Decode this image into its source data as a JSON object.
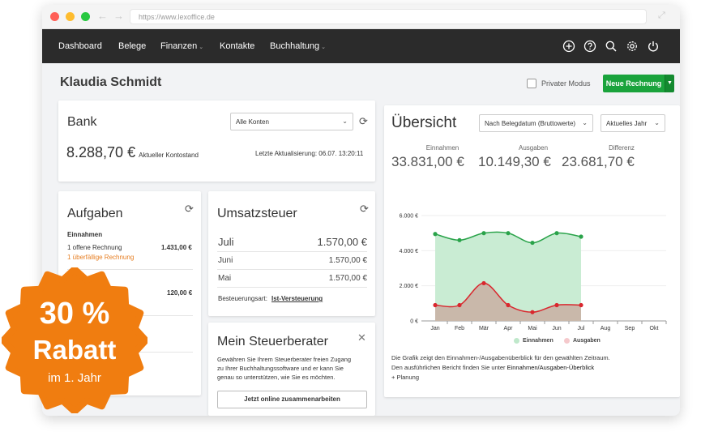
{
  "browser": {
    "url": "https://www.lexoffice.de"
  },
  "navbar": {
    "items": [
      {
        "label": "Dashboard"
      },
      {
        "label": "Belege"
      },
      {
        "label": "Finanzen"
      },
      {
        "label": "Kontakte"
      },
      {
        "label": "Buchhaltung"
      }
    ],
    "icons": [
      "plus-circle-icon",
      "help-icon",
      "search-icon",
      "gear-icon",
      "power-icon"
    ]
  },
  "header": {
    "user_name": "Klaudia Schmidt",
    "private_mode_label": "Privater Modus",
    "private_mode_checked": false,
    "new_invoice_label": "Neue Rechnung"
  },
  "bank": {
    "title": "Bank",
    "account_select": "Alle Konten",
    "balance": "8.288,70 €",
    "balance_label": "Aktueller Kontostand",
    "last_update": "Letzte Aktualisierung: 06.07.  13:20:11"
  },
  "tasks": {
    "title": "Aufgaben",
    "section_income": "Einnahmen",
    "open_invoices_label": "1  offene Rechnung",
    "open_invoices_amount": "1.431,00 €",
    "overdue_label": "1  überfällige Rechnung",
    "second_amount": "120,00 €"
  },
  "vat": {
    "title": "Umsatzsteuer",
    "rows": [
      {
        "month": "Juli",
        "amount": "1.570,00 €"
      },
      {
        "month": "Juni",
        "amount": "1.570,00 €"
      },
      {
        "month": "Mai",
        "amount": "1.570,00 €"
      }
    ],
    "taxation_label": "Besteuerungsart:",
    "taxation_value": "Ist-Versteuerung"
  },
  "advisor": {
    "title": "Mein Steuerberater",
    "text_line1": "Gewähren Sie Ihrem Steuerberater freien Zugang",
    "text_line2": "zu Ihrer Buchhaltungssoftware und er kann Sie",
    "text_line3": "genau so unterstützen, wie Sie es möchten.",
    "button_label": "Jetzt online zusammenarbeiten"
  },
  "overview": {
    "title": "Übersicht",
    "filter_select": "Nach Belegdatum (Bruttowerte)",
    "period_select": "Aktuelles Jahr",
    "kpis": [
      {
        "label": "Einnahmen",
        "value": "33.831,00 €"
      },
      {
        "label": "Ausgaben",
        "value": "10.149,30 €"
      },
      {
        "label": "Differenz",
        "value": "23.681,70 €"
      }
    ],
    "description_line1": "Die Grafik zeigt den Einnahmen-/Ausgabenüberblick für den gewählten Zeitraum.",
    "description_line2_prefix": "Den ausführlichen Bericht finden Sie unter ",
    "description_link": "Einnahmen/Ausgaben-Überblick",
    "description_line3": "+ Planung"
  },
  "chart_data": {
    "type": "area",
    "categories": [
      "Jan",
      "Feb",
      "Mär",
      "Apr",
      "Mai",
      "Jun",
      "Jul",
      "Aug",
      "Sep",
      "Okt"
    ],
    "y_ticks": [
      "0 €",
      "2.000 €",
      "4.000 €",
      "6.000 €"
    ],
    "ylim": [
      0,
      6000
    ],
    "series": [
      {
        "name": "Einnahmen",
        "color": "#2aa34a",
        "fill": "#c9ecd3",
        "values": [
          4950,
          4600,
          5000,
          5000,
          4450,
          5000,
          4800
        ]
      },
      {
        "name": "Ausgaben",
        "color": "#d9272e",
        "fill": "#c9b8aa",
        "values": [
          900,
          900,
          2150,
          900,
          500,
          900,
          900
        ]
      }
    ],
    "legend": "bottom"
  },
  "promo": {
    "percent": "30 %",
    "word": "Rabatt",
    "subtitle": "im 1. Jahr",
    "color": "#f07d10"
  }
}
